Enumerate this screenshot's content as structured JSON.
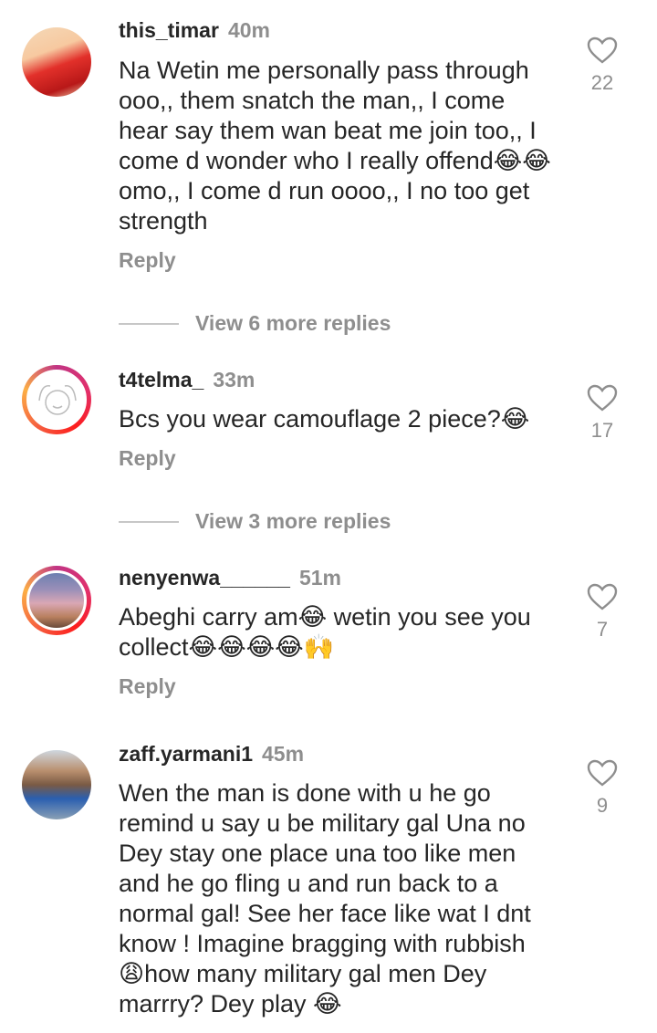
{
  "comments": [
    {
      "username": "this_timar",
      "time": "40m",
      "text": "Na Wetin me personally pass through ooo,, them snatch the man,, I come hear say them wan beat me join too,, I come d wonder who I really offend😂😂omo,, I come d run oooo,, I no too get strength",
      "reply_label": "Reply",
      "likes": "22",
      "more_replies": "View 6 more replies"
    },
    {
      "username": "t4telma_",
      "time": "33m",
      "text": "Bcs you wear camouflage 2 piece?😂",
      "reply_label": "Reply",
      "likes": "17",
      "more_replies": "View 3 more replies"
    },
    {
      "username": "nenyenwa______",
      "time": "51m",
      "text": "Abeghi carry am😂 wetin you see you collect😂😂😂😂🙌",
      "reply_label": "Reply",
      "likes": "7"
    },
    {
      "username": "zaff.yarmani1",
      "time": "45m",
      "text": "Wen the man is done with u he go remind u say u be military gal Una no Dey stay one place una too like men and he go fling u and run back to a normal gal! See her face like wat I dnt know ! Imagine bragging with rubbish 😩how many military gal men Dey marrry? Dey play 😂",
      "likes": "9"
    }
  ]
}
